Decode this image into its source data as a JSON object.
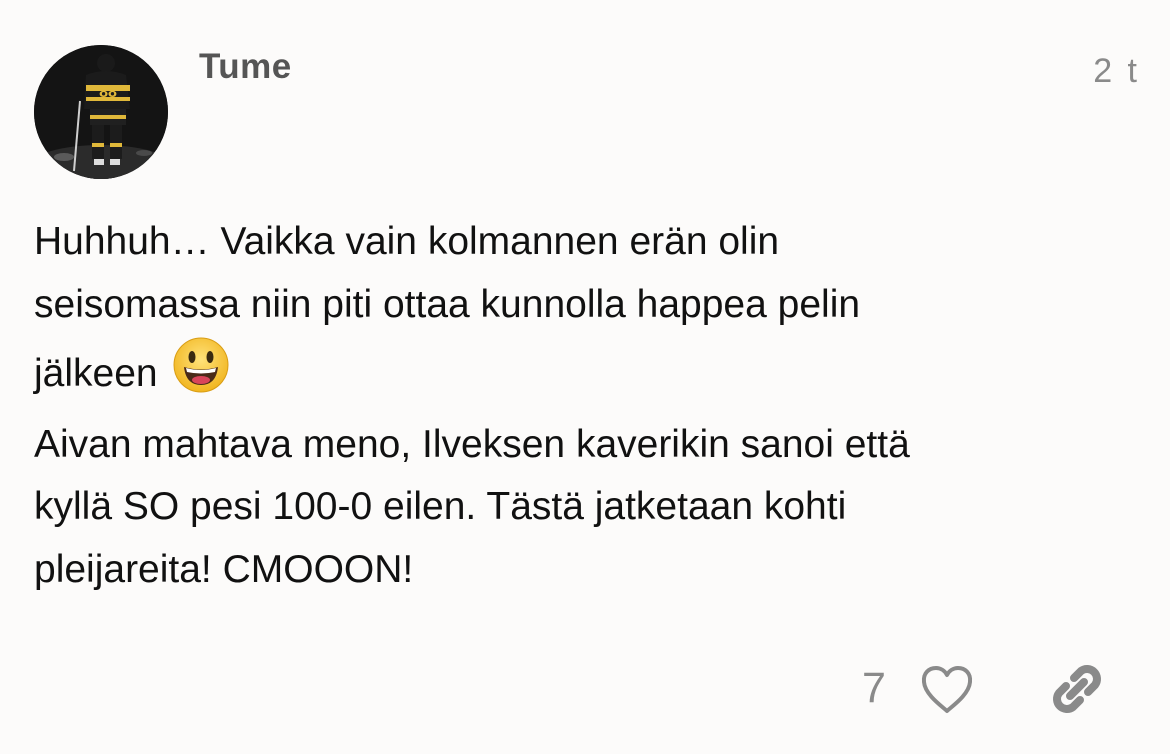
{
  "post": {
    "author": "Tume",
    "time": "2 t",
    "body_lines": [
      "Huhhuh… Vaikka vain kolmannen erän olin",
      "seisomassa niin piti ottaa kunnolla happea pelin",
      "jälkeen",
      "Aivan mahtava meno, Ilveksen kaverikin sanoi että",
      "kyllä SO pesi 100-0 eilen. Tästä jatketaan kohti",
      "pleijareita! CMOOON!"
    ],
    "emoji": "smiling-face-with-open-mouth",
    "like_count": "7"
  },
  "icons": {
    "like": "heart-outline-icon",
    "share": "link-icon"
  },
  "colors": {
    "background": "#fcfbfa",
    "text": "#111111",
    "muted": "#8a8a8a",
    "username": "#555555",
    "emoji_face": "#f7c531"
  }
}
